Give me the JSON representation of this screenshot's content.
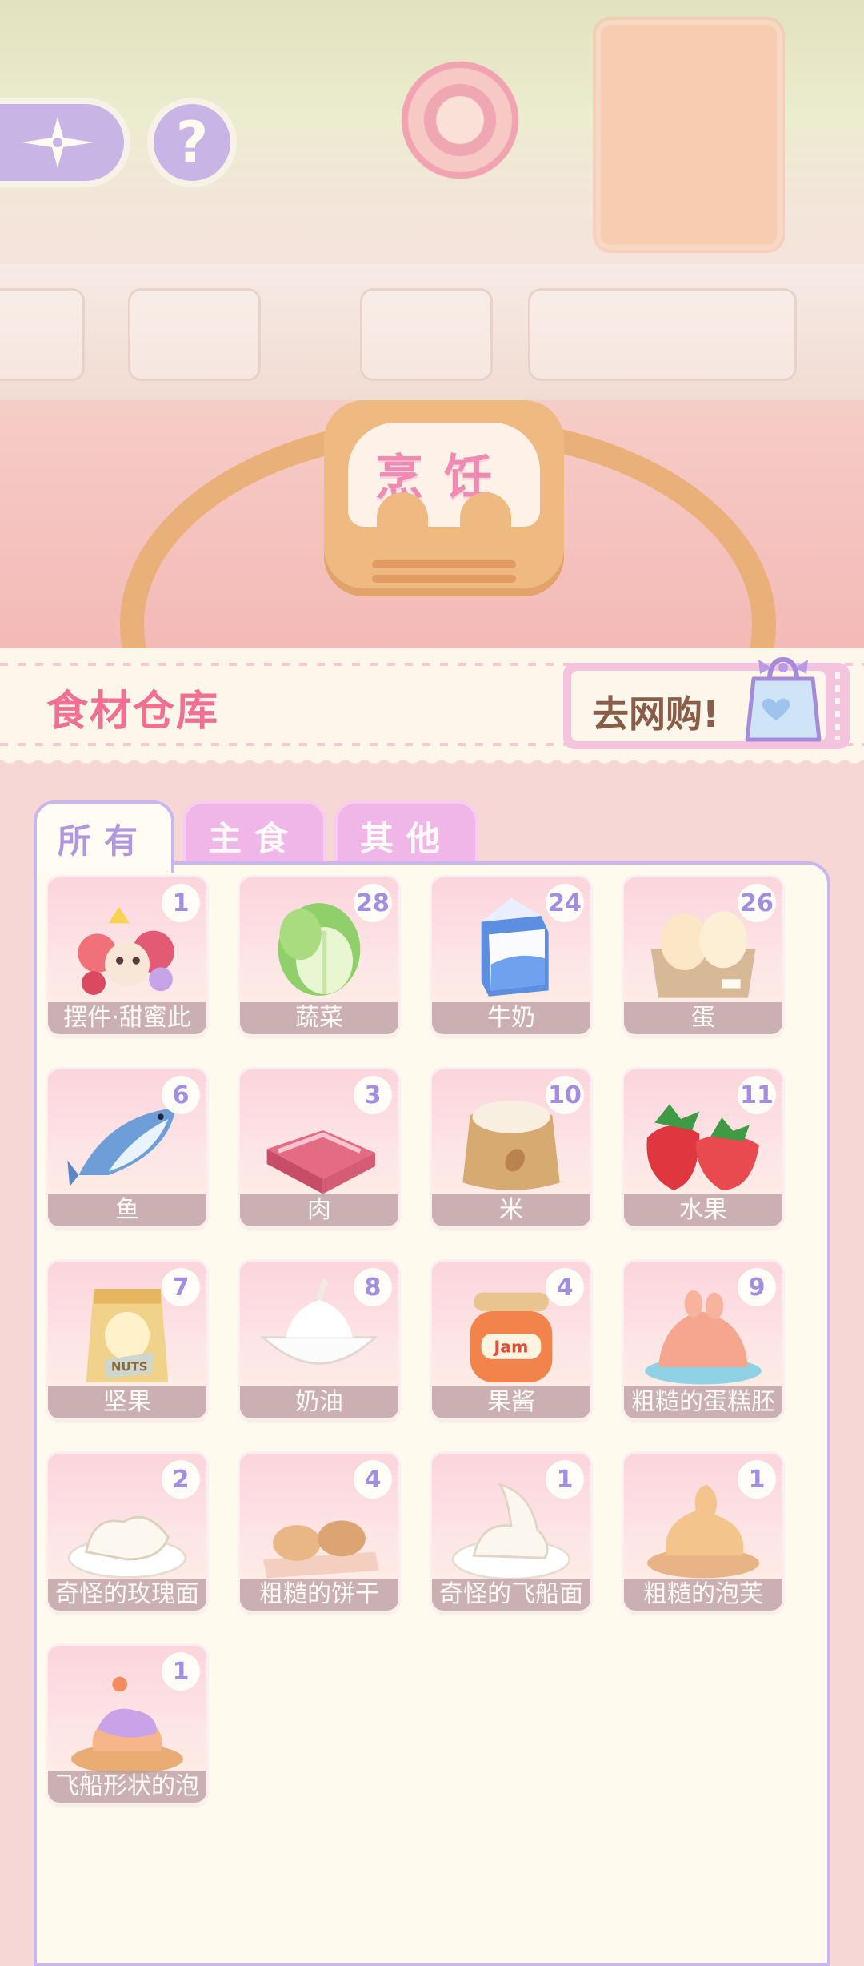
{
  "scene": {
    "sign_text": "烹饪"
  },
  "header": {
    "title": "食材仓库",
    "shop_label": "去网购!"
  },
  "tabs": [
    {
      "label": "所有",
      "active": true
    },
    {
      "label": "主食",
      "active": false
    },
    {
      "label": "其他",
      "active": false
    }
  ],
  "items": [
    {
      "name": "摆件·甜蜜此",
      "count": "1",
      "icon": "sweet-bouquet-icon"
    },
    {
      "name": "蔬菜",
      "count": "28",
      "icon": "cabbage-icon"
    },
    {
      "name": "牛奶",
      "count": "24",
      "icon": "milk-carton-icon"
    },
    {
      "name": "蛋",
      "count": "26",
      "icon": "eggs-icon"
    },
    {
      "name": "鱼",
      "count": "6",
      "icon": "fish-icon"
    },
    {
      "name": "肉",
      "count": "3",
      "icon": "meat-icon"
    },
    {
      "name": "米",
      "count": "10",
      "icon": "rice-sack-icon"
    },
    {
      "name": "水果",
      "count": "11",
      "icon": "strawberry-icon"
    },
    {
      "name": "坚果",
      "count": "7",
      "icon": "nuts-bag-icon"
    },
    {
      "name": "奶油",
      "count": "8",
      "icon": "cream-bowl-icon"
    },
    {
      "name": "果酱",
      "count": "4",
      "icon": "jam-jar-icon"
    },
    {
      "name": "粗糙的蛋糕胚",
      "count": "9",
      "icon": "cake-base-icon"
    },
    {
      "name": "奇怪的玫瑰面",
      "count": "2",
      "icon": "rose-bread-icon"
    },
    {
      "name": "粗糙的饼干",
      "count": "4",
      "icon": "biscuit-icon"
    },
    {
      "name": "奇怪的飞船面",
      "count": "1",
      "icon": "ship-bread-icon"
    },
    {
      "name": "粗糙的泡芙",
      "count": "1",
      "icon": "puff-icon"
    },
    {
      "name": "飞船形状的泡",
      "count": "1",
      "icon": "ship-puff-icon"
    }
  ],
  "colors": {
    "accent_pink": "#f06f92",
    "accent_purple": "#c9b7ec",
    "count_text": "#a28ee0"
  }
}
